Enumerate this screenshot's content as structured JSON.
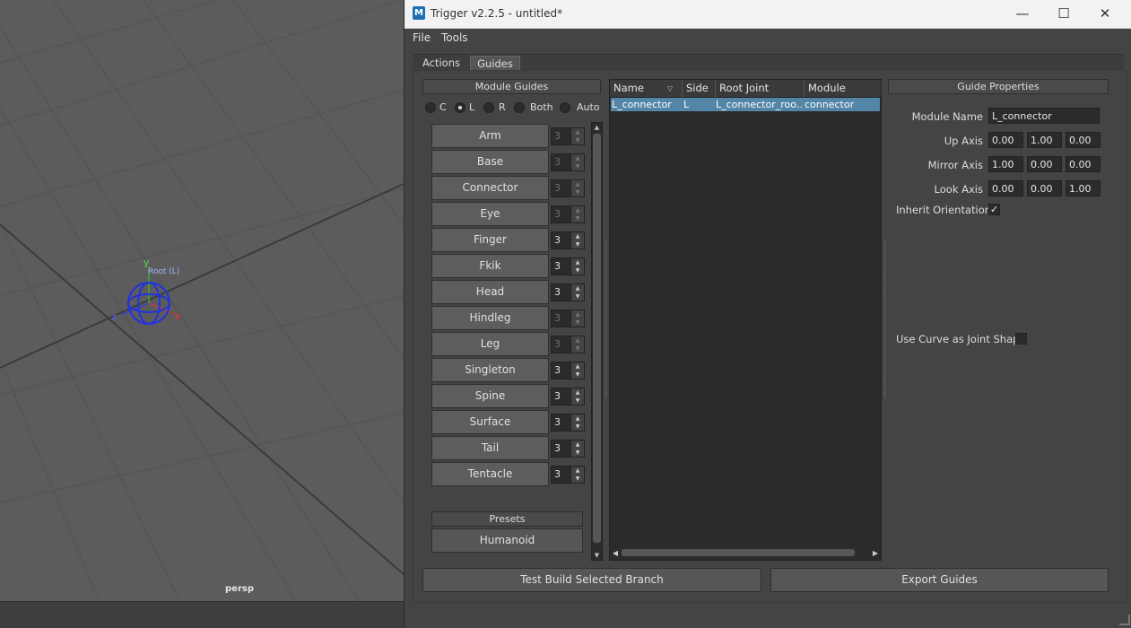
{
  "viewport": {
    "camera_label": "persp",
    "root_label": "Root (L)",
    "axis_y": "y",
    "axis_z": "z",
    "axis_x": "x"
  },
  "window": {
    "icon": "maya-app-icon",
    "title": "Trigger v2.2.5 - untitled*",
    "controls": {
      "minimize": "—",
      "maximize": "☐",
      "close": "✕"
    }
  },
  "menu": [
    "File",
    "Tools"
  ],
  "tabs": [
    {
      "label": "Actions",
      "active": false
    },
    {
      "label": "Guides",
      "active": true
    }
  ],
  "module_guides": {
    "header": "Module Guides",
    "side_options": [
      {
        "label": "C",
        "checked": false
      },
      {
        "label": "L",
        "checked": true
      },
      {
        "label": "R",
        "checked": false
      },
      {
        "label": "Both",
        "checked": false
      },
      {
        "label": "Auto",
        "checked": false
      }
    ],
    "modules": [
      {
        "label": "Arm",
        "count": "3",
        "enabled": false
      },
      {
        "label": "Base",
        "count": "3",
        "enabled": false
      },
      {
        "label": "Connector",
        "count": "3",
        "enabled": false
      },
      {
        "label": "Eye",
        "count": "3",
        "enabled": false
      },
      {
        "label": "Finger",
        "count": "3",
        "enabled": true
      },
      {
        "label": "Fkik",
        "count": "3",
        "enabled": true
      },
      {
        "label": "Head",
        "count": "3",
        "enabled": true
      },
      {
        "label": "Hindleg",
        "count": "3",
        "enabled": false
      },
      {
        "label": "Leg",
        "count": "3",
        "enabled": false
      },
      {
        "label": "Singleton",
        "count": "3",
        "enabled": true
      },
      {
        "label": "Spine",
        "count": "3",
        "enabled": true
      },
      {
        "label": "Surface",
        "count": "3",
        "enabled": true
      },
      {
        "label": "Tail",
        "count": "3",
        "enabled": true
      },
      {
        "label": "Tentacle",
        "count": "3",
        "enabled": true
      }
    ],
    "presets_header": "Presets",
    "presets": [
      "Humanoid"
    ]
  },
  "tree": {
    "columns": [
      "Name",
      "Side",
      "Root Joint",
      "Module"
    ],
    "rows": [
      {
        "name": "L_connector",
        "side": "L",
        "root_joint": "L_connector_roo…",
        "module": "connector",
        "selected": true
      }
    ]
  },
  "guide_properties": {
    "header": "Guide Properties",
    "module_name_label": "Module Name",
    "module_name": "L_connector",
    "up_axis_label": "Up Axis",
    "up_axis": [
      "0.00",
      "1.00",
      "0.00"
    ],
    "mirror_axis_label": "Mirror Axis",
    "mirror_axis": [
      "1.00",
      "0.00",
      "0.00"
    ],
    "look_axis_label": "Look Axis",
    "look_axis": [
      "0.00",
      "0.00",
      "1.00"
    ],
    "inherit_orientation_label": "Inherit Orientation",
    "inherit_orientation": true,
    "use_curve_label": "Use Curve as Joint Shape",
    "use_curve": false
  },
  "bottom_buttons": {
    "test_build": "Test Build Selected Branch",
    "export": "Export Guides"
  }
}
